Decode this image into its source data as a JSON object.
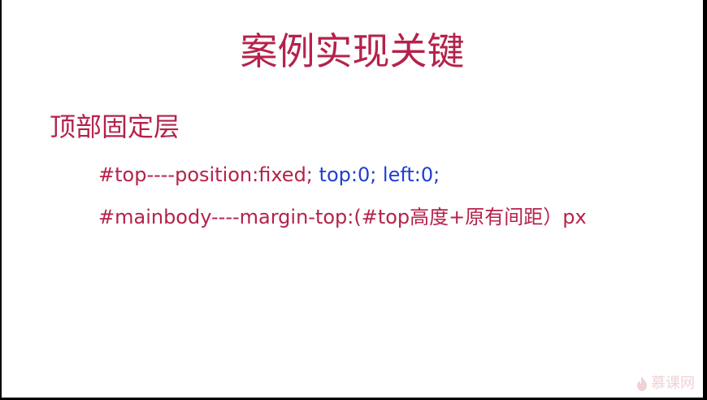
{
  "slide": {
    "title": "案例实现关键",
    "heading": "顶部固定层",
    "line1": {
      "part1": "#top----position:fixed; ",
      "part2": "top:0; left:0;"
    },
    "line2": "#mainbody----margin-top:(#top高度+原有间距）px",
    "watermark_text": "慕课网",
    "watermark_icon": "flame-icon"
  },
  "colors": {
    "accent": "#b5224a",
    "highlight": "#1f3fd0",
    "background": "#ffffff",
    "frame": "#000000"
  }
}
